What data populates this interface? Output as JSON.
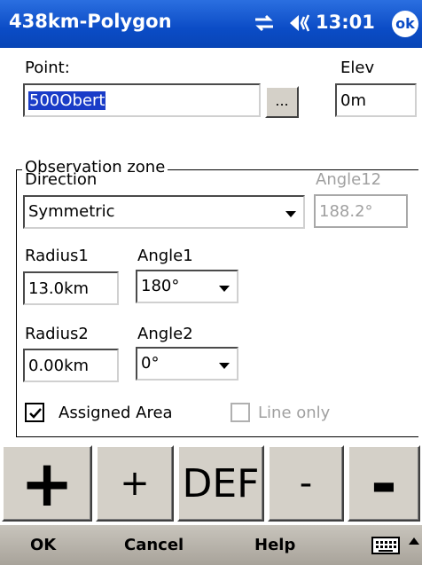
{
  "titlebar": {
    "title": "438km-Polygon",
    "clock": "13:01",
    "ok_label": "ok"
  },
  "point": {
    "label": "Point:",
    "value": "500Obert",
    "browse_label": "..."
  },
  "elev": {
    "label": "Elev",
    "value": "0m"
  },
  "observation_zone": {
    "legend": "Observation zone",
    "direction_label": "Direction",
    "direction_value": "Symmetric",
    "angle12_label": "Angle12",
    "angle12_value": "188.2°",
    "radius1_label": "Radius1",
    "radius1_value": "13.0km",
    "angle1_label": "Angle1",
    "angle1_value": "180°",
    "radius2_label": "Radius2",
    "radius2_value": "0.00km",
    "angle2_label": "Angle2",
    "angle2_value": "0°",
    "assigned_area_label": "Assigned Area",
    "assigned_area_checked": true,
    "line_only_label": "Line only",
    "line_only_checked": false
  },
  "big_buttons": {
    "big_plus": "+",
    "small_plus": "+",
    "def": "DEF",
    "small_minus": "-",
    "big_minus": "-"
  },
  "menubar": {
    "ok": "OK",
    "cancel": "Cancel",
    "help": "Help",
    "keyboard_icon": "keyboard-icon"
  },
  "colors": {
    "titlebar": "#0b4cc6",
    "selection": "#1a3cc8",
    "button_face": "#d4d0c8"
  }
}
